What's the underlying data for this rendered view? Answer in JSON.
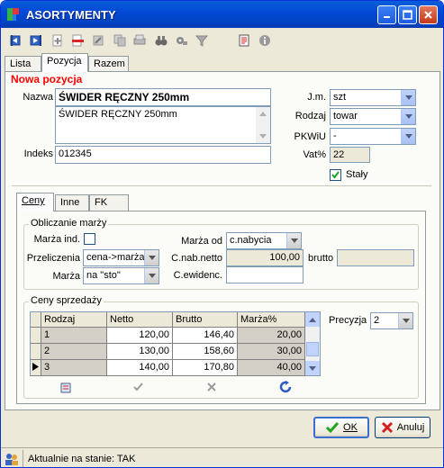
{
  "window": {
    "title": "ASORTYMENTY"
  },
  "main_tabs": [
    {
      "label": "Lista"
    },
    {
      "label": "Pozycja"
    },
    {
      "label": "Razem"
    }
  ],
  "header": {
    "section_title": "Nowa pozycja"
  },
  "form": {
    "nazwa_label": "Nazwa",
    "nazwa_value": "ŚWIDER RĘCZNY 250mm",
    "opis_value": "ŚWIDER RĘCZNY 250mm",
    "indeks_label": "Indeks",
    "indeks_value": "012345",
    "jm_label": "J.m.",
    "jm_value": "szt",
    "rodzaj_label": "Rodzaj",
    "rodzaj_value": "towar",
    "pkwiu_label": "PKWiU",
    "pkwiu_value": "-",
    "vat_label": "Vat%",
    "vat_value": "22",
    "staly_label": "Stały",
    "staly_checked": true
  },
  "sub_tabs": [
    {
      "label": "Ceny"
    },
    {
      "label": "Inne"
    },
    {
      "label": "FK"
    }
  ],
  "marza": {
    "group_title": "Obliczanie marży",
    "marza_ind_label": "Marża ind.",
    "przeliczenia_label": "Przeliczenia",
    "przeliczenia_value": "cena->marża",
    "marza_label": "Marża",
    "marza_value": "na \"sto\"",
    "marza_od_label": "Marża od",
    "marza_od_value": "c.nabycia",
    "cnab_netto_label": "C.nab.netto",
    "cnab_netto_value": "100,00",
    "brutto_label": "brutto",
    "brutto_value": "",
    "cewid_label": "C.ewidenc.",
    "cewid_value": ""
  },
  "ceny": {
    "group_title": "Ceny sprzedaży",
    "columns": [
      "Rodzaj",
      "Netto",
      "Brutto",
      "Marża%"
    ],
    "rows": [
      {
        "rodzaj": "1",
        "netto": "120,00",
        "brutto": "146,40",
        "marza": "20,00"
      },
      {
        "rodzaj": "2",
        "netto": "130,00",
        "brutto": "158,60",
        "marza": "30,00"
      },
      {
        "rodzaj": "3",
        "netto": "140,00",
        "brutto": "170,80",
        "marza": "40,00"
      }
    ],
    "precyzja_label": "Precyzja",
    "precyzja_value": "2"
  },
  "buttons": {
    "ok_label": "OK",
    "anuluj_label": "Anuluj"
  },
  "status": {
    "text": "Aktualnie na stanie: TAK"
  },
  "colors": {
    "section_title": "#ff0000",
    "titlebar": "#0349d6"
  }
}
